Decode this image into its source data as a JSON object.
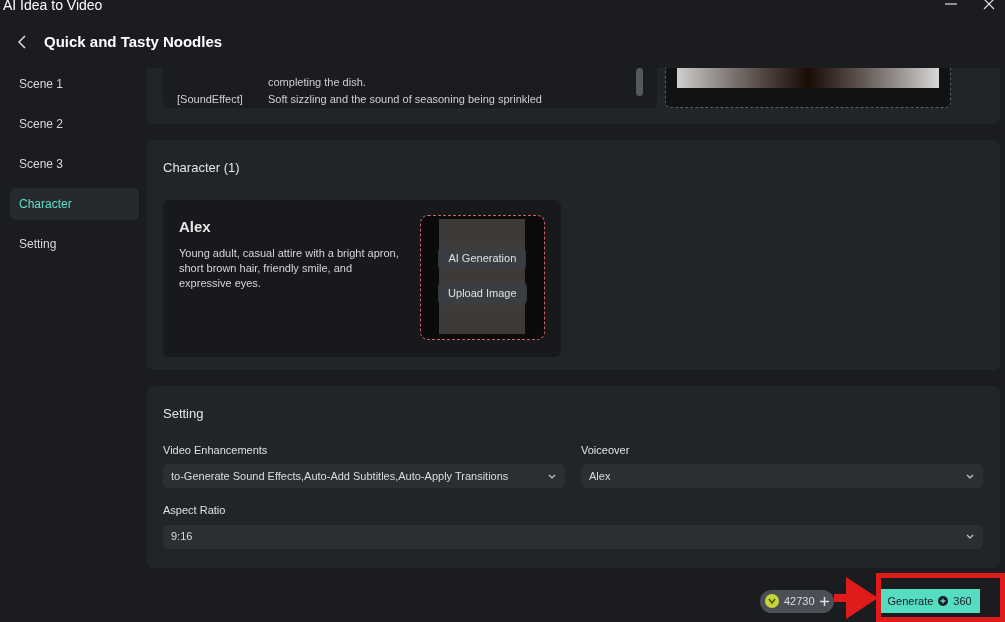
{
  "window": {
    "title": "AI Idea to Video"
  },
  "header": {
    "title": "Quick and Tasty Noodles"
  },
  "sidebar": {
    "items": [
      {
        "label": "Scene 1",
        "selected": false
      },
      {
        "label": "Scene 2",
        "selected": false
      },
      {
        "label": "Scene 3",
        "selected": false
      },
      {
        "label": "Character",
        "selected": true
      },
      {
        "label": "Setting",
        "selected": false
      }
    ]
  },
  "scene_card": {
    "lines": [
      {
        "text": "completing the dish."
      },
      {
        "tag": "[SoundEffect]",
        "text": "Soft sizzling and the sound of seasoning being sprinkled"
      }
    ]
  },
  "character_section": {
    "title": "Character (1)",
    "characters": [
      {
        "name": "Alex",
        "description": "Young adult, casual attire with a bright apron, short brown hair, friendly smile, and expressive eyes.",
        "buttons": [
          "AI Generation",
          "Upload Image"
        ]
      }
    ]
  },
  "setting_section": {
    "title": "Setting",
    "fields": [
      {
        "kind": "half",
        "label": "Video Enhancements",
        "value": "to-Generate Sound Effects,Auto-Add Subtitles,Auto-Apply Transitions"
      },
      {
        "kind": "half",
        "label": "Voiceover",
        "value": "Alex"
      },
      {
        "kind": "full",
        "label": "Aspect Ratio",
        "value": "9:16"
      }
    ]
  },
  "footer": {
    "credits": "42730",
    "generate_button": {
      "label": "Generate",
      "cost": "360"
    }
  }
}
